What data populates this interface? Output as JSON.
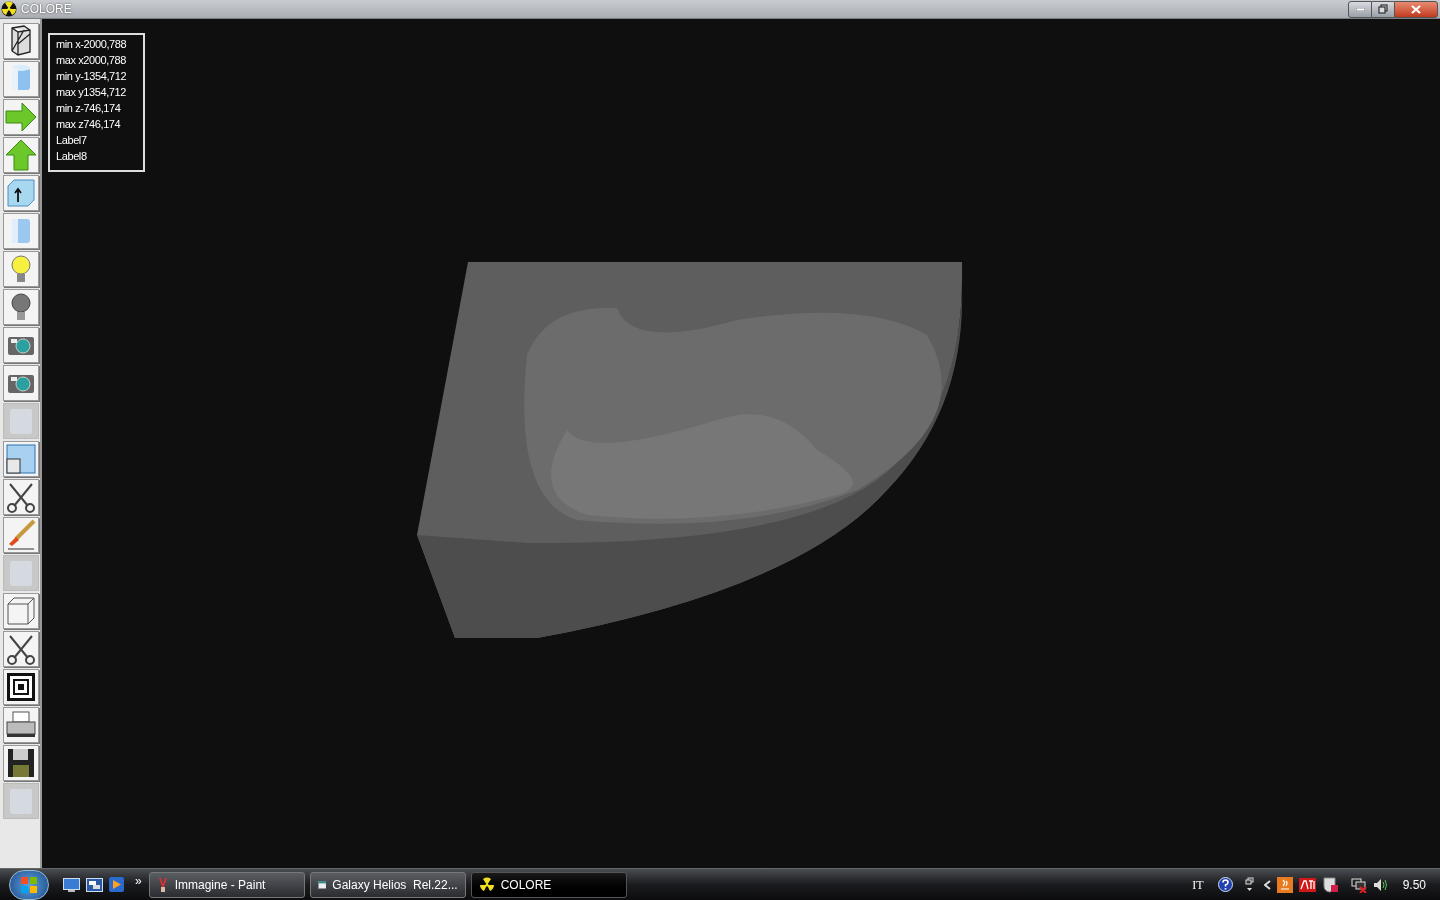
{
  "window": {
    "title": "COLORE"
  },
  "toolbar": [
    {
      "disabled": false
    },
    {
      "disabled": false
    },
    {
      "disabled": false
    },
    {
      "disabled": false
    },
    {
      "disabled": false
    },
    {
      "disabled": false
    },
    {
      "disabled": false
    },
    {
      "disabled": false
    },
    {
      "disabled": false
    },
    {
      "disabled": false
    },
    {
      "disabled": true
    },
    {
      "disabled": false
    },
    {
      "disabled": false
    },
    {
      "disabled": false
    },
    {
      "disabled": true
    },
    {
      "disabled": false
    },
    {
      "disabled": false
    },
    {
      "disabled": false
    },
    {
      "disabled": false
    },
    {
      "disabled": false
    },
    {
      "disabled": true
    }
  ],
  "info_labels": [
    "min x-2000,788",
    "max x2000,788",
    "min y-1354,712",
    "max y1354,712",
    "min z-746,174",
    "max z746,174",
    "Label7",
    "Label8"
  ],
  "taskbar": {
    "more": "»",
    "tasks": [
      {
        "label": "Immagine - Paint",
        "selected": false
      },
      {
        "label": "Galaxy Helios  Rel.22...",
        "selected": false
      },
      {
        "label": "COLORE",
        "selected": true
      }
    ],
    "language": "IT",
    "clock": "9.50"
  }
}
